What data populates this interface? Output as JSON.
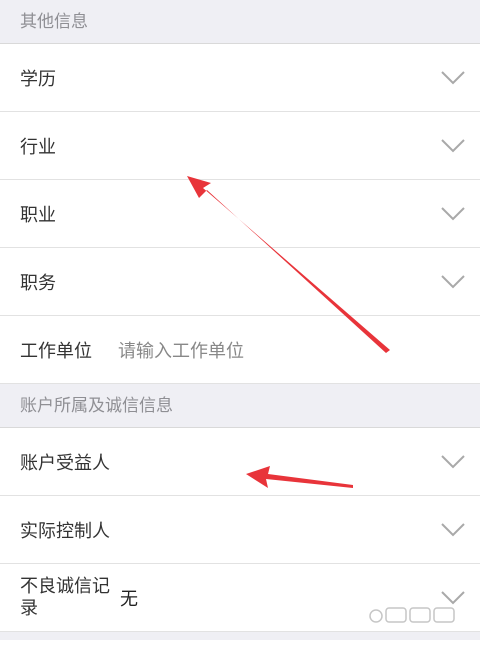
{
  "sections": [
    {
      "title": "其他信息",
      "rows": [
        {
          "label": "学历"
        },
        {
          "label": "行业"
        },
        {
          "label": "职业"
        },
        {
          "label": "职务"
        },
        {
          "label": "工作单位",
          "placeholder": "请输入工作单位"
        }
      ]
    },
    {
      "title": "账户所属及诚信信息",
      "rows": [
        {
          "label": "账户受益人"
        },
        {
          "label": "实际控制人"
        },
        {
          "label": "不良诚信记录",
          "value": "无"
        }
      ]
    }
  ],
  "icons": {
    "chevron": "chevron-down-icon",
    "arrow": "red-arrow-annotation",
    "watermark": "baidu-jingyan-watermark"
  },
  "colors": {
    "section_bg": "#efeff4",
    "section_text": "#8f8f94",
    "arrow_red": "#e8343a",
    "chevron": "#a9a9a9"
  }
}
